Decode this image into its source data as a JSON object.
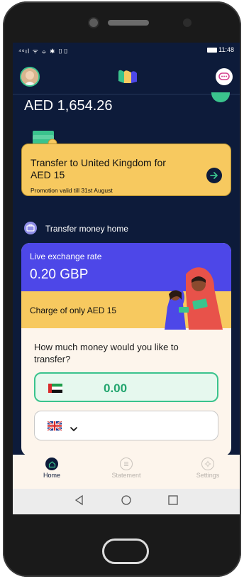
{
  "status_bar": {
    "left_icons": "⁴⁶ıl ᯤ ⦵ ✱ ▯▯",
    "time": "11:48"
  },
  "account": {
    "balance": "AED 1,654.26"
  },
  "promo": {
    "title": "Transfer to United Kingdom for AED 15",
    "subtitle": "Promotion valid till 31st August"
  },
  "section": {
    "label": "Transfer money home"
  },
  "rate_card": {
    "label": "Live exchange rate",
    "value": "0.20 GBP",
    "charge": "Charge of only AED 15"
  },
  "transfer_form": {
    "question": "How much money would you like to transfer?",
    "amount": "0.00",
    "from_currency_flag": "uae-flag-icon",
    "to_currency_flag": "uk-flag-icon"
  },
  "bottom_nav": [
    {
      "label": "Home",
      "icon": "home-icon",
      "active": true
    },
    {
      "label": "Statement",
      "icon": "statement-icon",
      "active": false
    },
    {
      "label": "Settings",
      "icon": "gear-icon",
      "active": false
    }
  ],
  "colors": {
    "background": "#0d1b3a",
    "accent_green": "#3ac38d",
    "promo_yellow": "#f7c95f",
    "rate_purple": "#4d47e8",
    "card_cream": "#fdf5ec"
  }
}
